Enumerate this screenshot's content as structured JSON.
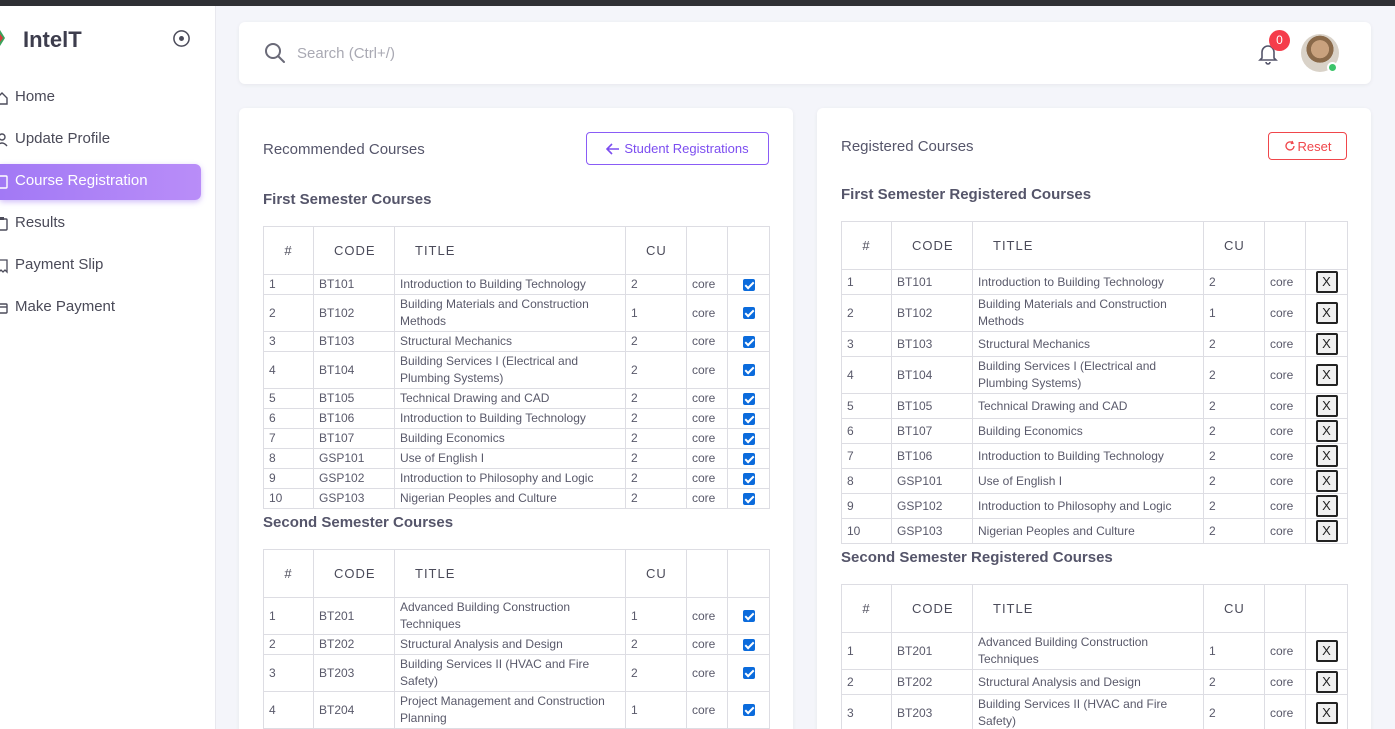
{
  "brand": {
    "name": "IntelT",
    "colors": {
      "accent": "#a279f5",
      "danger": "#f0464b",
      "checkbox": "#0b6bdc"
    }
  },
  "sidebar": {
    "items": [
      {
        "label": "Home",
        "icon": "home-icon"
      },
      {
        "label": "Update Profile",
        "icon": "user-icon"
      },
      {
        "label": "Course Registration",
        "icon": "book-icon",
        "active": true
      },
      {
        "label": "Results",
        "icon": "clipboard-icon"
      },
      {
        "label": "Payment Slip",
        "icon": "receipt-icon"
      },
      {
        "label": "Make Payment",
        "icon": "credit-card-icon"
      }
    ]
  },
  "header": {
    "search_placeholder": "Search (Ctrl+/)",
    "notification_count": "0"
  },
  "left": {
    "title": "Recommended Courses",
    "button_label": "Student Registrations",
    "first_title": "First Semester Courses",
    "second_title": "Second Semester Courses",
    "columns": [
      "#",
      "CODE",
      "TITLE",
      "CU",
      "",
      ""
    ],
    "first": [
      [
        "1",
        "BT101",
        "Introduction to Building Technology",
        "2",
        "core"
      ],
      [
        "2",
        "BT102",
        "Building Materials and Construction Methods",
        "1",
        "core"
      ],
      [
        "3",
        "BT103",
        "Structural Mechanics",
        "2",
        "core"
      ],
      [
        "4",
        "BT104",
        "Building Services I (Electrical and Plumbing Systems)",
        "2",
        "core"
      ],
      [
        "5",
        "BT105",
        "Technical Drawing and CAD",
        "2",
        "core"
      ],
      [
        "6",
        "BT106",
        "Introduction to Building Technology",
        "2",
        "core"
      ],
      [
        "7",
        "BT107",
        "Building Economics",
        "2",
        "core"
      ],
      [
        "8",
        "GSP101",
        "Use of English I",
        "2",
        "core"
      ],
      [
        "9",
        "GSP102",
        "Introduction to Philosophy and Logic",
        "2",
        "core"
      ],
      [
        "10",
        "GSP103",
        "Nigerian Peoples and Culture",
        "2",
        "core"
      ]
    ],
    "second": [
      [
        "1",
        "BT201",
        "Advanced Building Construction Techniques",
        "1",
        "core"
      ],
      [
        "2",
        "BT202",
        "Structural Analysis and Design",
        "2",
        "core"
      ],
      [
        "3",
        "BT203",
        "Building Services II (HVAC and Fire Safety)",
        "2",
        "core"
      ],
      [
        "4",
        "BT204",
        "Project Management and Construction Planning",
        "1",
        "core"
      ]
    ]
  },
  "right": {
    "title": "Registered Courses",
    "button_label": "Reset",
    "first_title": "First Semester Registered Courses",
    "second_title": "Second Semester Registered Courses",
    "remove_label": "X",
    "columns": [
      "#",
      "CODE",
      "TITLE",
      "CU",
      "",
      ""
    ],
    "first": [
      [
        "1",
        "BT101",
        "Introduction to Building Technology",
        "2",
        "core"
      ],
      [
        "2",
        "BT102",
        "Building Materials and Construction Methods",
        "1",
        "core"
      ],
      [
        "3",
        "BT103",
        "Structural Mechanics",
        "2",
        "core"
      ],
      [
        "4",
        "BT104",
        "Building Services I (Electrical and Plumbing Systems)",
        "2",
        "core"
      ],
      [
        "5",
        "BT105",
        "Technical Drawing and CAD",
        "2",
        "core"
      ],
      [
        "6",
        "BT107",
        "Building Economics",
        "2",
        "core"
      ],
      [
        "7",
        "BT106",
        "Introduction to Building Technology",
        "2",
        "core"
      ],
      [
        "8",
        "GSP101",
        "Use of English I",
        "2",
        "core"
      ],
      [
        "9",
        "GSP102",
        "Introduction to Philosophy and Logic",
        "2",
        "core"
      ],
      [
        "10",
        "GSP103",
        "Nigerian Peoples and Culture",
        "2",
        "core"
      ]
    ],
    "second": [
      [
        "1",
        "BT201",
        "Advanced Building Construction Techniques",
        "1",
        "core"
      ],
      [
        "2",
        "BT202",
        "Structural Analysis and Design",
        "2",
        "core"
      ],
      [
        "3",
        "BT203",
        "Building Services II (HVAC and Fire Safety)",
        "2",
        "core"
      ]
    ]
  }
}
